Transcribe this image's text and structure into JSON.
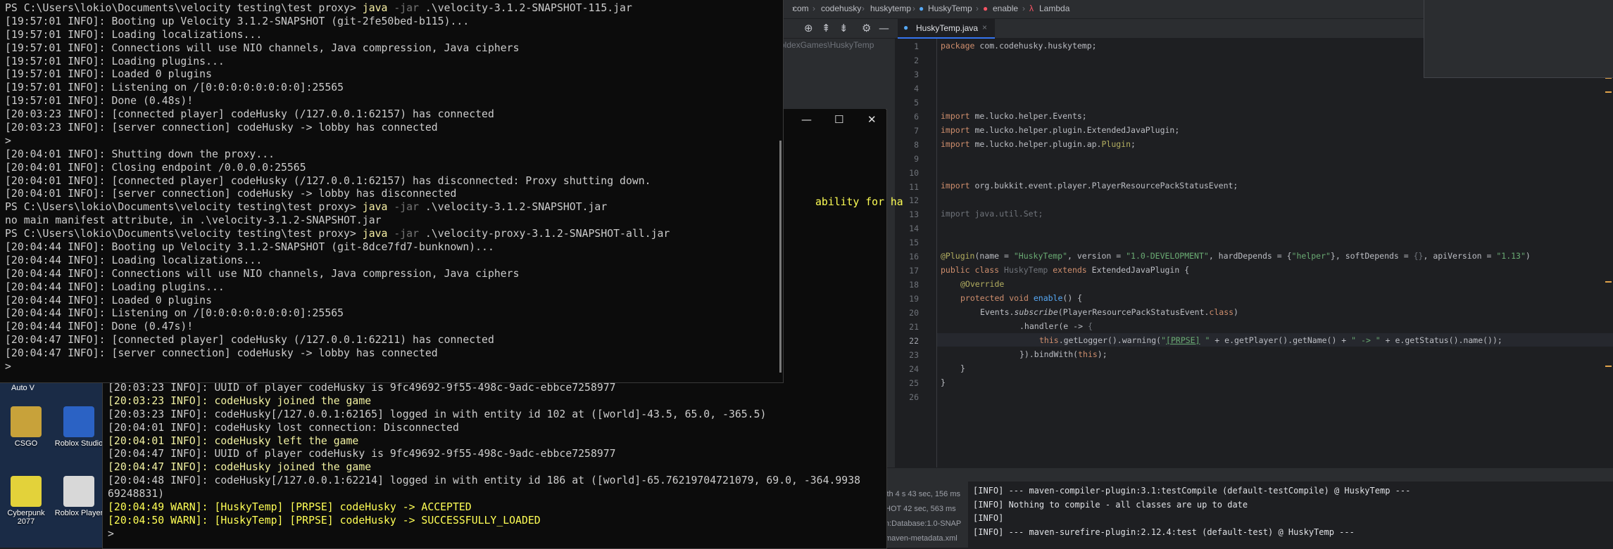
{
  "ide": {
    "breadcrumbs": [
      "com",
      "codehusky",
      "huskytemp",
      "HuskyTemp",
      "enable",
      "Lambda"
    ],
    "project_path_fragment": "oldexGames\\HuskyTemp",
    "tab": {
      "label": "HuskyTemp.java",
      "close": "×"
    },
    "toolbar_icons": [
      "target-icon",
      "collapse-icon",
      "expand-icon",
      "gear-icon",
      "minimize-icon"
    ],
    "toolbar_glyphs": [
      "⊕",
      "⇞",
      "⇟",
      "⚙",
      "—"
    ],
    "line_numbers": [
      "1",
      "2",
      "3",
      "4",
      "5",
      "6",
      "7",
      "8",
      "9",
      "10",
      "11",
      "12",
      "13",
      "14",
      "15",
      "16",
      "17",
      "18",
      "19",
      "20",
      "21",
      "22",
      "23",
      "24",
      "25",
      "26"
    ],
    "code": {
      "l1": [
        "package",
        " com.codehusky.huskytemp;"
      ],
      "l6": [
        "import",
        " me.lucko.helper.Events;"
      ],
      "l7": [
        "import",
        " me.lucko.helper.plugin.ExtendedJavaPlugin;"
      ],
      "l8": [
        "import",
        " me.lucko.helper.plugin.ap.",
        "Plugin",
        ";"
      ],
      "l11": [
        "import",
        " org.bukkit.event.player.PlayerResourcePackStatusEvent;"
      ],
      "l13": "import java.util.Set;",
      "l16": [
        "@Plugin",
        "(name = ",
        "\"HuskyTemp\"",
        ", version = ",
        "\"1.0-DEVELOPMENT\"",
        ", hardDepends = {",
        "\"helper\"",
        "}, softDepends = ",
        "{}",
        ", apiVersion = ",
        "\"1.13\"",
        ")"
      ],
      "l17": [
        "public class ",
        "HuskyTemp",
        " extends ",
        "ExtendedJavaPlugin {"
      ],
      "l18": "@Override",
      "l19": [
        "protected void ",
        "enable",
        "() {"
      ],
      "l20": [
        "Events.",
        "subscribe",
        "(PlayerResourcePackStatusEvent.",
        "class",
        ")"
      ],
      "l21": [
        ".handler(e -> ",
        "{"
      ],
      "l22": [
        "this",
        ".getLogger().warning(",
        "\"",
        "[PRPSE]",
        " \"",
        " + e.getPlayer().getName() + ",
        "\" -> \"",
        " + e.getStatus().name());"
      ],
      "l23": [
        "}).bindWith(",
        "this",
        ");"
      ],
      "l24": "}",
      "l25": "}"
    },
    "build_side": [
      "ith 4 s 43 sec, 156 ms",
      "HOT 42 sec, 563 ms",
      "n:Database:1.0-SNAP",
      "maven-metadata.xml"
    ],
    "build_output": [
      "[INFO] --- maven-compiler-plugin:3.1:testCompile (default-testCompile) @ HuskyTemp ---",
      "[INFO] Nothing to compile - all classes are up to date",
      "[INFO]",
      "[INFO] --- maven-surefire-plugin:2.12.4:test (default-test) @ HuskyTemp ---"
    ]
  },
  "desktop": {
    "autov_label": "Auto V",
    "icons": [
      {
        "label": "CSGO",
        "color": "#c8a23a"
      },
      {
        "label": "Roblox Studio",
        "color": "#2b62c4"
      },
      {
        "label": "Cyberpunk 2077",
        "color": "#e3d23a"
      },
      {
        "label": "Roblox Player",
        "color": "#d8d8d8"
      }
    ]
  },
  "server_console": {
    "window_controls": [
      "—",
      "☐",
      "✕"
    ],
    "peek_text": "ability for ha",
    "lines": [
      "[20:03:23 INFO]: UUID of player codeHusky is 9fc49692-9f55-498c-9adc-ebbce7258977",
      "[20:03:23 INFO]: codeHusky joined the game",
      "[20:03:23 INFO]: codeHusky[/127.0.0.1:62165] logged in with entity id 102 at ([world]-43.5, 65.0, -365.5)",
      "[20:04:01 INFO]: codeHusky lost connection: Disconnected",
      "[20:04:01 INFO]: codeHusky left the game",
      "[20:04:47 INFO]: UUID of player codeHusky is 9fc49692-9f55-498c-9adc-ebbce7258977",
      "[20:04:47 INFO]: codeHusky joined the game",
      "[20:04:48 INFO]: codeHusky[/127.0.0.1:62214] logged in with entity id 186 at ([world]-65.76219704721079, 69.0, -364.9938",
      "69248831)",
      "[20:04:49 WARN]: [HuskyTemp] [PRPSE] codeHusky -> ACCEPTED",
      "[20:04:50 WARN]: [HuskyTemp] [PRPSE] codeHusky -> SUCCESSFULLY_LOADED",
      ">"
    ]
  },
  "proxy_console": {
    "lines": [
      "PS C:\\Users\\lokio\\Documents\\velocity testing\\test proxy> java -jar .\\velocity-3.1.2-SNAPSHOT-115.jar",
      "[19:57:01 INFO]: Booting up Velocity 3.1.2-SNAPSHOT (git-2fe50bed-b115)...",
      "[19:57:01 INFO]: Loading localizations...",
      "[19:57:01 INFO]: Connections will use NIO channels, Java compression, Java ciphers",
      "[19:57:01 INFO]: Loading plugins...",
      "[19:57:01 INFO]: Loaded 0 plugins",
      "[19:57:01 INFO]: Listening on /[0:0:0:0:0:0:0:0]:25565",
      "[19:57:01 INFO]: Done (0.48s)!",
      "[20:03:23 INFO]: [connected player] codeHusky (/127.0.0.1:62157) has connected",
      "[20:03:23 INFO]: [server connection] codeHusky -> lobby has connected",
      ">",
      "[20:04:01 INFO]: Shutting down the proxy...",
      "[20:04:01 INFO]: Closing endpoint /0.0.0.0:25565",
      "[20:04:01 INFO]: [connected player] codeHusky (/127.0.0.1:62157) has disconnected: Proxy shutting down.",
      "[20:04:01 INFO]: [server connection] codeHusky -> lobby has disconnected",
      "PS C:\\Users\\lokio\\Documents\\velocity testing\\test proxy> java -jar .\\velocity-3.1.2-SNAPSHOT.jar",
      "no main manifest attribute, in .\\velocity-3.1.2-SNAPSHOT.jar",
      "PS C:\\Users\\lokio\\Documents\\velocity testing\\test proxy> java -jar .\\velocity-proxy-3.1.2-SNAPSHOT-all.jar",
      "[20:04:44 INFO]: Booting up Velocity 3.1.2-SNAPSHOT (git-8dce7fd7-bunknown)...",
      "[20:04:44 INFO]: Loading localizations...",
      "[20:04:44 INFO]: Connections will use NIO channels, Java compression, Java ciphers",
      "[20:04:44 INFO]: Loading plugins...",
      "[20:04:44 INFO]: Loaded 0 plugins",
      "[20:04:44 INFO]: Listening on /[0:0:0:0:0:0:0:0]:25565",
      "[20:04:44 INFO]: Done (0.47s)!",
      "[20:04:47 INFO]: [connected player] codeHusky (/127.0.0.1:62211) has connected",
      "[20:04:47 INFO]: [server connection] codeHusky -> lobby has connected",
      ">"
    ]
  }
}
